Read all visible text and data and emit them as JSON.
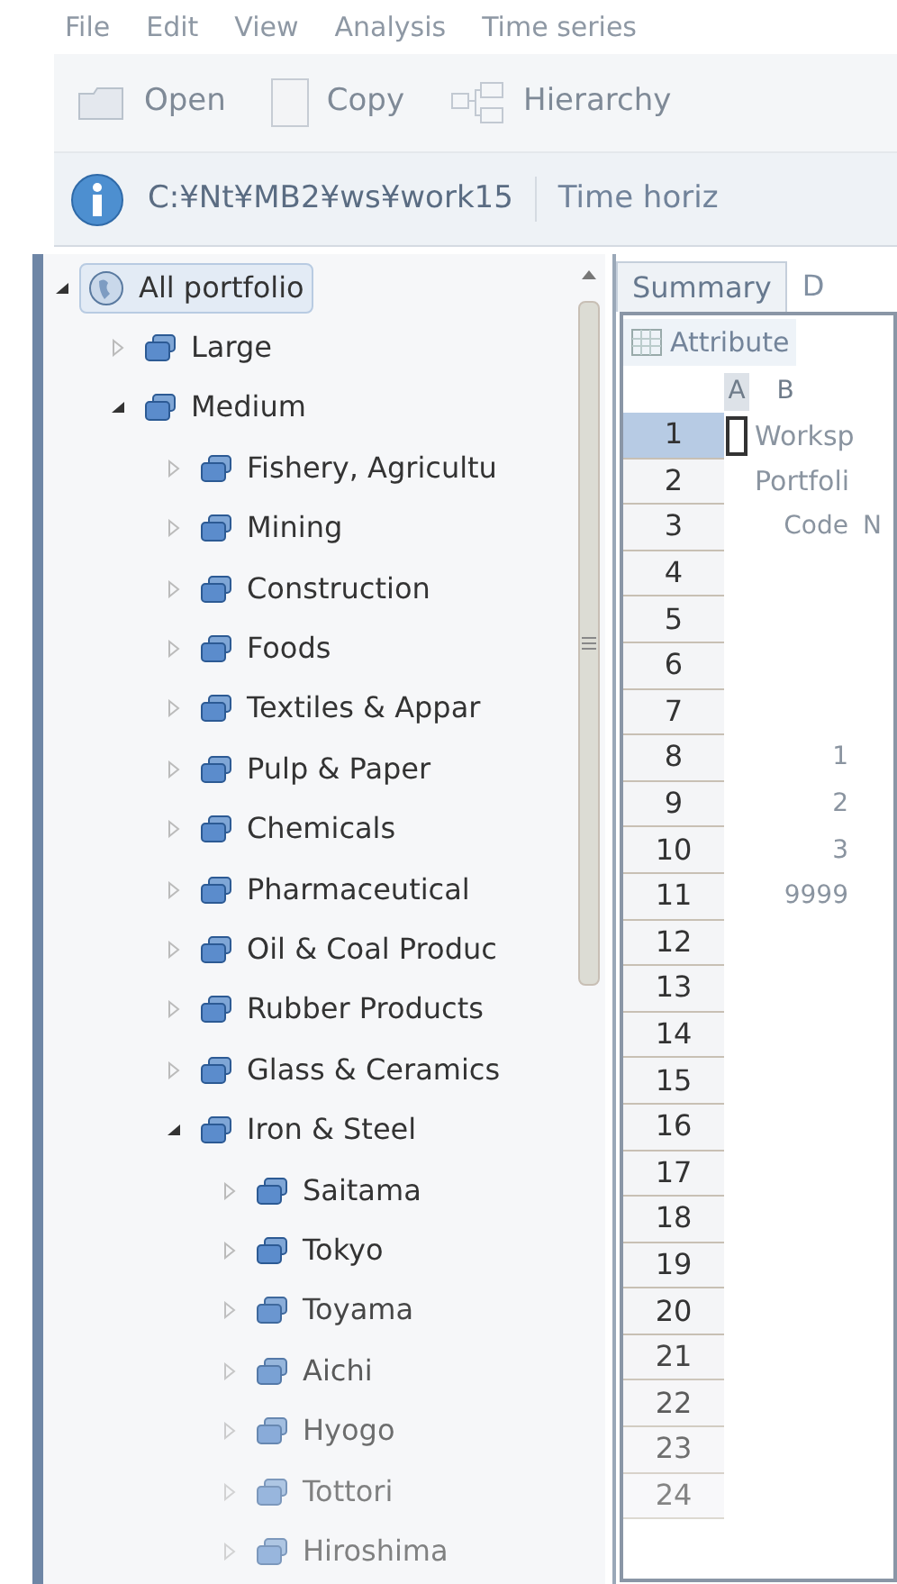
{
  "menu": [
    "File",
    "Edit",
    "View",
    "Analysis",
    "Time series"
  ],
  "toolbar": [
    {
      "label": "Open",
      "kind": "open"
    },
    {
      "label": "Copy",
      "kind": "copy"
    },
    {
      "label": "Hierarchy",
      "kind": "hierarchy"
    }
  ],
  "path_bar": {
    "path": "C:¥Nt¥MB2¥ws¥work15",
    "time_label": "Time horiz"
  },
  "tree": [
    {
      "label": "All portfolio",
      "kind": "root",
      "expanded": true,
      "selected": true,
      "children": [
        {
          "label": "Large",
          "expanded": false,
          "selected": false
        },
        {
          "label": "Medium",
          "expanded": true,
          "selected": false,
          "children": [
            {
              "label": "Fishery, Agricultu",
              "expanded": false,
              "selected": false
            },
            {
              "label": "Mining",
              "expanded": false,
              "selected": false
            },
            {
              "label": "Construction",
              "expanded": false,
              "selected": false
            },
            {
              "label": "Foods",
              "expanded": false,
              "selected": false
            },
            {
              "label": "Textiles & Appar",
              "expanded": false,
              "selected": false
            },
            {
              "label": "Pulp & Paper",
              "expanded": false,
              "selected": false
            },
            {
              "label": "Chemicals",
              "expanded": false,
              "selected": false
            },
            {
              "label": "Pharmaceutical",
              "expanded": false,
              "selected": false
            },
            {
              "label": "Oil & Coal Produc",
              "expanded": false,
              "selected": false
            },
            {
              "label": "Rubber Products",
              "expanded": false,
              "selected": false
            },
            {
              "label": "Glass & Ceramics",
              "expanded": false,
              "selected": false
            },
            {
              "label": "Iron & Steel",
              "expanded": true,
              "selected": false,
              "children": [
                {
                  "label": "Saitama",
                  "expanded": false,
                  "selected": false
                },
                {
                  "label": "Tokyo",
                  "expanded": false,
                  "selected": false
                },
                {
                  "label": "Toyama",
                  "expanded": false,
                  "selected": false
                },
                {
                  "label": "Aichi",
                  "expanded": false,
                  "selected": false
                },
                {
                  "label": "Hyogo",
                  "expanded": false,
                  "selected": false
                },
                {
                  "label": "Tottori",
                  "expanded": false,
                  "selected": false
                },
                {
                  "label": "Hiroshima",
                  "expanded": false,
                  "selected": false
                }
              ]
            }
          ]
        }
      ]
    }
  ],
  "tabs": [
    {
      "label": "Summary",
      "selected": true
    },
    {
      "label": "D",
      "selected": false
    }
  ],
  "sheet_tab": {
    "label": "Attribute"
  },
  "grid": {
    "columns": [
      "A",
      "B"
    ],
    "rows": [
      {
        "number": "1",
        "selected": true,
        "text": "Worksp"
      },
      {
        "number": "2",
        "selected": false,
        "text": "Portfoli"
      },
      {
        "number": "3",
        "selected": false,
        "code": "Code",
        "name": "N"
      },
      {
        "number": "4",
        "selected": false
      },
      {
        "number": "5",
        "selected": false
      },
      {
        "number": "6",
        "selected": false
      },
      {
        "number": "7",
        "selected": false
      },
      {
        "number": "8",
        "selected": false,
        "code": "1"
      },
      {
        "number": "9",
        "selected": false,
        "code": "2"
      },
      {
        "number": "10",
        "selected": false,
        "code": "3"
      },
      {
        "number": "11",
        "selected": false,
        "code": "9999"
      },
      {
        "number": "12",
        "selected": false
      },
      {
        "number": "13",
        "selected": false
      },
      {
        "number": "14",
        "selected": false
      },
      {
        "number": "15",
        "selected": false
      },
      {
        "number": "16",
        "selected": false
      },
      {
        "number": "17",
        "selected": false
      },
      {
        "number": "18",
        "selected": false
      },
      {
        "number": "19",
        "selected": false
      },
      {
        "number": "20",
        "selected": false
      },
      {
        "number": "21",
        "selected": false
      },
      {
        "number": "22",
        "selected": false
      },
      {
        "number": "23",
        "selected": false
      },
      {
        "number": "24",
        "selected": false
      }
    ]
  }
}
